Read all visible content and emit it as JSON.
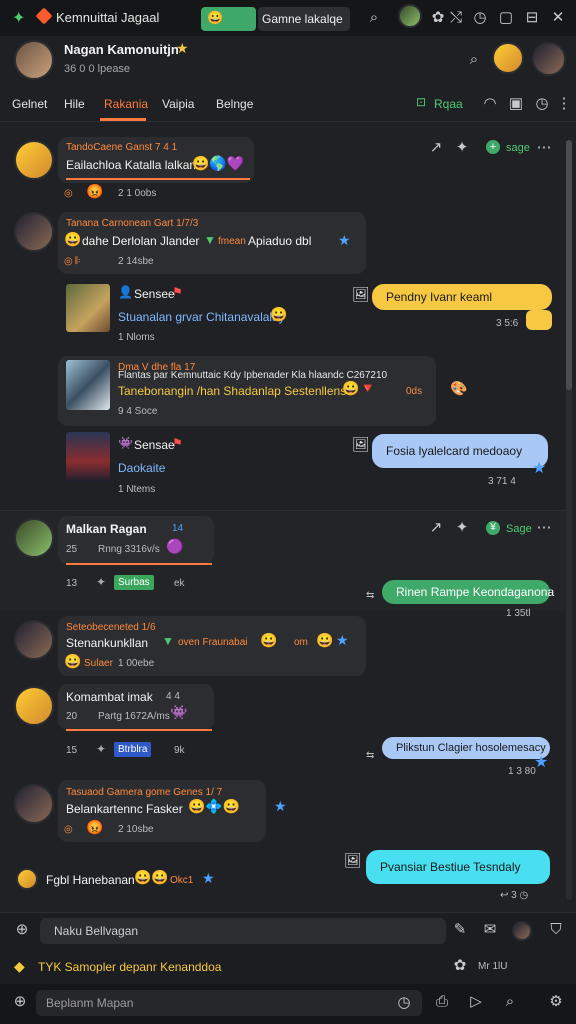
{
  "topbar": {
    "title": "Kemnuittai Jagaal",
    "green_pill": "",
    "tab_label": "Gamne lakalqe"
  },
  "header": {
    "name": "Nagan Kamonuitjn",
    "status": "36 0 0 lpease"
  },
  "tabs": [
    {
      "label": "Gelnet"
    },
    {
      "label": "Hile"
    },
    {
      "label": "Rakania",
      "active": true
    },
    {
      "label": "Vaipia"
    },
    {
      "label": "Belnge"
    }
  ],
  "tabs_right": {
    "label": "Rqaa"
  },
  "chat": {
    "group1": {
      "sub": "TandoCaene Ganst 7 4 1",
      "message": "Eailachloa Katalla lalkan",
      "meta": "2 1 0obs",
      "right_action": "sage"
    },
    "group2": {
      "sub": "Tanana Carnonean Gart 1/7/3",
      "message": "dahe Derlolan Jlander",
      "message_extra": "Apiaduo dbl",
      "chip": "fmean",
      "meta": "2 14sbe"
    },
    "item1": {
      "title": "Sensee",
      "message": "Stuanalan grvar Chitanavalalay",
      "meta": "1 Nloms"
    },
    "item2": {
      "title": "Dma V dhe fla 17",
      "sub": "Flantas par Kemnuttaic Kdy Ipbenader Kla hlaandc C267210",
      "message": "Tanebonangin /han Shadanlap Sestenllens",
      "message_extra": "0ds",
      "meta": "9 4 Soce"
    },
    "item3": {
      "title": "Sensae",
      "message": "Daokaite",
      "meta": "1 Ntems"
    },
    "right1": {
      "text": "Pendny Ivanr keaml",
      "meta": "3 5:6"
    },
    "right2": {
      "text": "Fosia lyalelcard medoaoy",
      "meta": "3 71 4"
    },
    "mention1": {
      "name": "Malkan Ragan",
      "badge": "14",
      "meta_num": "25",
      "meta": "Rnng 3316v/s",
      "row_num": "13",
      "chip": "Surbas",
      "chip_extra": "ek",
      "right_action": "Sage"
    },
    "right3": {
      "text": "Rinen Rampe Keondaganona",
      "meta": "1 35tl"
    },
    "group3": {
      "sub": "Seteobeceneted 1/6",
      "message": "Stenankunkllan",
      "message_extra": "oven Fraunabai",
      "suffix": "om",
      "meta_label": "Sulaer",
      "meta": "1 00ebe"
    },
    "mention2": {
      "name": "Komambat imak",
      "badge": "4 4",
      "meta_num": "20",
      "meta": "Partg 1672A/ms",
      "row_num": "15",
      "chip": "Btrblra",
      "chip_extra": "9k"
    },
    "right4": {
      "text": "Plikstun Clagier hosolemesacy",
      "meta": "1 3 80"
    },
    "group4": {
      "sub": "Tasuaod Gamera gome Genes 1/ 7",
      "message": "Belankartennc Fasker",
      "meta": "2 10sbe"
    },
    "group5": {
      "message": "Fgbl Hanebanan",
      "extra": "Okc1"
    },
    "right5": {
      "text": "Pvansiar Bestiue Tesndaly"
    }
  },
  "input1": {
    "placeholder": "Naku Bellvagan"
  },
  "status": {
    "text": "TYK Samopler depanr Kenanddoa",
    "right": "Mr 1lU"
  },
  "input2": {
    "placeholder": "Beplanm Mapan"
  },
  "colors": {
    "accent": "#ff7a3d",
    "green": "#3fa96a",
    "yellow_bubble": "#f7c842",
    "blue_bubble": "#a9c8f5",
    "cyan_bubble": "#48dff0"
  }
}
